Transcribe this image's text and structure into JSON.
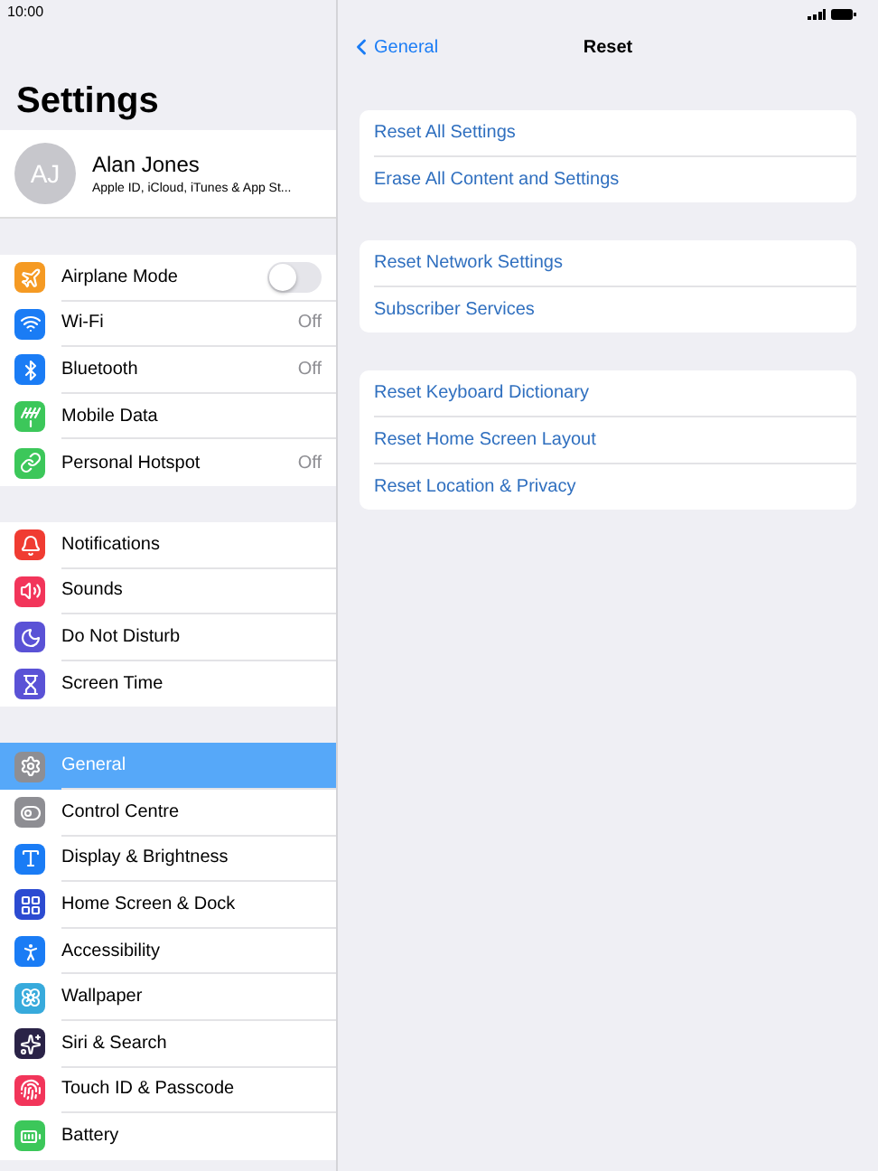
{
  "status_bar": {
    "time": "10:00"
  },
  "sidebar": {
    "title": "Settings",
    "profile": {
      "initials": "AJ",
      "name": "Alan Jones",
      "subtitle": "Apple ID, iCloud, iTunes & App St..."
    },
    "groups": [
      {
        "items": [
          {
            "label": "Airplane Mode",
            "kind": "toggle",
            "on": false,
            "color": "#f59a23",
            "selected": false
          },
          {
            "label": "Wi-Fi",
            "kind": "value",
            "value": "Off",
            "color": "#1a7cf5",
            "selected": false
          },
          {
            "label": "Bluetooth",
            "kind": "value",
            "value": "Off",
            "color": "#1a7cf5",
            "selected": false
          },
          {
            "label": "Mobile Data",
            "kind": "link",
            "color": "#3cc75a",
            "selected": false
          },
          {
            "label": "Personal Hotspot",
            "kind": "value",
            "value": "Off",
            "color": "#3cc75a",
            "selected": false
          }
        ]
      },
      {
        "items": [
          {
            "label": "Notifications",
            "kind": "link",
            "color": "#f03c32",
            "selected": false
          },
          {
            "label": "Sounds",
            "kind": "link",
            "color": "#f2355a",
            "selected": false
          },
          {
            "label": "Do Not Disturb",
            "kind": "link",
            "color": "#5a52d6",
            "selected": false
          },
          {
            "label": "Screen Time",
            "kind": "link",
            "color": "#5a52d6",
            "selected": false
          }
        ]
      },
      {
        "items": [
          {
            "label": "General",
            "kind": "link",
            "color": "#8e8e93",
            "selected": true
          },
          {
            "label": "Control Centre",
            "kind": "link",
            "color": "#8e8e93",
            "selected": false
          },
          {
            "label": "Display & Brightness",
            "kind": "link",
            "color": "#1a7cf5",
            "selected": false
          },
          {
            "label": "Home Screen & Dock",
            "kind": "link",
            "color": "#2c4bd1",
            "selected": false
          },
          {
            "label": "Accessibility",
            "kind": "link",
            "color": "#1a7cf5",
            "selected": false
          },
          {
            "label": "Wallpaper",
            "kind": "link",
            "color": "#37aadc",
            "selected": false
          },
          {
            "label": "Siri & Search",
            "kind": "link",
            "color": "#2a2347",
            "selected": false
          },
          {
            "label": "Touch ID & Passcode",
            "kind": "link",
            "color": "#f2355a",
            "selected": false
          },
          {
            "label": "Battery",
            "kind": "link",
            "color": "#3cc75a",
            "selected": false
          }
        ]
      }
    ]
  },
  "detail": {
    "back": "General",
    "title": "Reset",
    "groups": [
      {
        "items": [
          "Reset All Settings",
          "Erase All Content and Settings"
        ]
      },
      {
        "items": [
          "Reset Network Settings",
          "Subscriber Services"
        ]
      },
      {
        "items": [
          "Reset Keyboard Dictionary",
          "Reset Home Screen Layout",
          "Reset Location & Privacy"
        ]
      }
    ]
  }
}
